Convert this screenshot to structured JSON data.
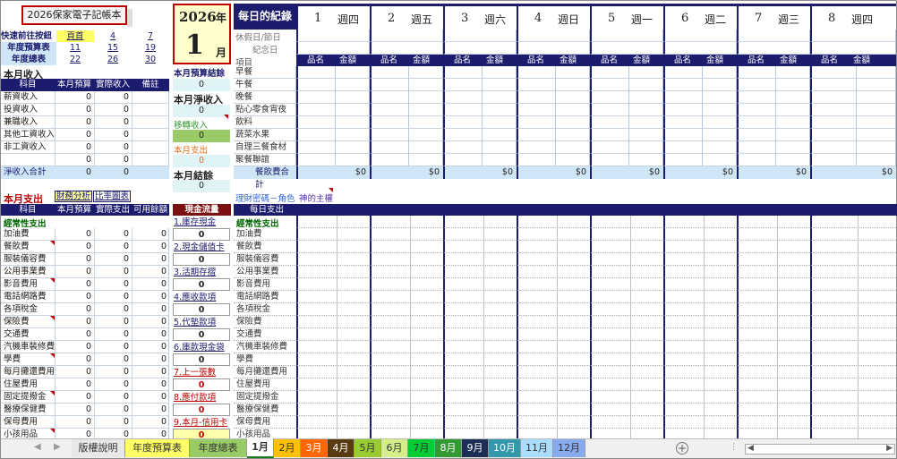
{
  "title_button": "2026保家電子記帳本",
  "quick_nav": {
    "label": "快速前往按鈕",
    "rows": [
      {
        "label": "",
        "links": [
          "頁首",
          "4",
          "7"
        ]
      },
      {
        "label": "年度預算表",
        "links": [
          "11",
          "15",
          "19"
        ]
      },
      {
        "label": "年度總表",
        "links": [
          "22",
          "26",
          "30"
        ]
      }
    ]
  },
  "year_month": {
    "year": "2026",
    "year_unit": "年",
    "month": "1",
    "month_unit": "月"
  },
  "income": {
    "title": "本月收入",
    "headers": [
      "科目",
      "本月預算",
      "實際收入",
      "備註"
    ],
    "rows": [
      {
        "name": "薪資收入",
        "budget": "0",
        "actual": "0"
      },
      {
        "name": "投資收入",
        "budget": "0",
        "actual": "0"
      },
      {
        "name": "兼職收入",
        "budget": "0",
        "actual": "0"
      },
      {
        "name": "其他工資收入",
        "budget": "0",
        "actual": "0"
      },
      {
        "name": "非工資收入",
        "budget": "0",
        "actual": "0"
      },
      {
        "name": "",
        "budget": "0",
        "actual": "0"
      }
    ],
    "total": {
      "name": "淨收入合計",
      "budget": "0",
      "actual": "0"
    }
  },
  "summary": {
    "budget_result_label": "本月預算結餘",
    "budget_result": "0",
    "net_income_label": "本月淨收入",
    "net_income": "0",
    "transfer_label": "移轉收入",
    "transfer": "0",
    "expense_label": "本月支出",
    "expense": "0",
    "balance_label": "本月結餘",
    "balance": "0"
  },
  "expense": {
    "title": "本月支出",
    "links": [
      "財務分析",
      "比率圖表"
    ],
    "headers": [
      "科目",
      "本月預算",
      "實際支出",
      "可用餘額"
    ],
    "section": "經常性支出",
    "rows": [
      {
        "name": "加油費",
        "v": [
          "0",
          "0",
          "0"
        ]
      },
      {
        "name": "餐飲費",
        "v": [
          "0",
          "0",
          "0"
        ]
      },
      {
        "name": "服裝儀容費",
        "v": [
          "0",
          "0",
          "0"
        ]
      },
      {
        "name": "公用事業費",
        "v": [
          "0",
          "0",
          "0"
        ]
      },
      {
        "name": "影音費用",
        "v": [
          "0",
          "0",
          "0"
        ]
      },
      {
        "name": "電話網路費",
        "v": [
          "0",
          "0",
          "0"
        ]
      },
      {
        "name": "各項稅金",
        "v": [
          "0",
          "0",
          "0"
        ]
      },
      {
        "name": "保險費",
        "v": [
          "0",
          "0",
          "0"
        ]
      },
      {
        "name": "交通費",
        "v": [
          "0",
          "0",
          "0"
        ]
      },
      {
        "name": "汽機車裝修費",
        "v": [
          "0",
          "0",
          "0"
        ]
      },
      {
        "name": "學費",
        "v": [
          "0",
          "0",
          "0"
        ]
      },
      {
        "name": "每月攤還費用",
        "v": [
          "0",
          "0",
          "0"
        ]
      },
      {
        "name": "住屋費用",
        "v": [
          "0",
          "0",
          "0"
        ]
      },
      {
        "name": "固定提撥金",
        "v": [
          "0",
          "0",
          "0"
        ]
      },
      {
        "name": "醫療保健費",
        "v": [
          "0",
          "0",
          "0"
        ]
      },
      {
        "name": "保母費用",
        "v": [
          "0",
          "0",
          "0"
        ]
      },
      {
        "name": "小孩用品",
        "v": [
          "0",
          "0",
          "0"
        ]
      }
    ]
  },
  "cash_flow": {
    "title": "現金流量",
    "items": [
      {
        "label": "1.庫存現金",
        "value": "0",
        "red": false
      },
      {
        "label": "2.現金儲值卡",
        "value": "0",
        "red": false
      },
      {
        "label": "3.活期存摺",
        "value": "0",
        "red": false
      },
      {
        "label": "4.應收款項",
        "value": "0",
        "red": false
      },
      {
        "label": "5.代墊款項",
        "value": "0",
        "red": false
      },
      {
        "label": "6.庫款現金袋",
        "value": "0",
        "red": false
      },
      {
        "label": "7.上一張數",
        "value": "0",
        "red": true
      },
      {
        "label": "8.應付款項",
        "value": "0",
        "red": true
      },
      {
        "label": "9.本月-信用卡",
        "value": "0",
        "red": true
      }
    ]
  },
  "daily": {
    "title": "每日的紀錄",
    "days": [
      {
        "d": "1",
        "w": "週四"
      },
      {
        "d": "2",
        "w": "週五"
      },
      {
        "d": "3",
        "w": "週六"
      },
      {
        "d": "4",
        "w": "週日"
      },
      {
        "d": "5",
        "w": "週一"
      },
      {
        "d": "6",
        "w": "週二"
      },
      {
        "d": "7",
        "w": "週三"
      },
      {
        "d": "8",
        "w": "週四"
      }
    ],
    "holiday_label": "休假日/節日",
    "memorial_label": "紀念日",
    "item_label": "項目",
    "col_name": "品名",
    "col_amount": "金額",
    "meals": [
      "早餐",
      "午餐",
      "晚餐",
      "點心零食宵夜",
      "飲料",
      "蔬菜水果",
      "自理三餐食材",
      "聚餐聯誼"
    ],
    "meal_total_label": "餐飲費合計",
    "meal_total_value": "$0",
    "note1": "理財密碼－角色",
    "note2": "神的主權",
    "expense_header": "每日支出",
    "expense_section": "經常性支出",
    "expense_items": [
      "加油費",
      "餐飲費",
      "服裝儀容費",
      "公用事業費",
      "影音費用",
      "電話網路費",
      "各項稅金",
      "保險費",
      "交通費",
      "汽機車裝修費",
      "學費",
      "每月攤還費用",
      "住屋費用",
      "固定提撥金",
      "醫療保健費",
      "保母費用",
      "小孩用品"
    ]
  },
  "sheet_tabs": [
    {
      "label": "版權說明",
      "bg": "#e8e8e8",
      "fg": "#333333"
    },
    {
      "label": "年度預算表",
      "bg": "#ffff66",
      "fg": "#333333"
    },
    {
      "label": "年度總表",
      "bg": "#99cc66",
      "fg": "#333333"
    },
    {
      "label": "1月",
      "bg": "#ffffff",
      "fg": "#333333"
    },
    {
      "label": "2月",
      "bg": "#ffc000",
      "fg": "#333333"
    },
    {
      "label": "3月",
      "bg": "#ff6600",
      "fg": "#ffffff"
    },
    {
      "label": "4月",
      "bg": "#5a3a10",
      "fg": "#ffffff"
    },
    {
      "label": "5月",
      "bg": "#99cc33",
      "fg": "#333333"
    },
    {
      "label": "6月",
      "bg": "#d4ee88",
      "fg": "#333333"
    },
    {
      "label": "7月",
      "bg": "#00cc33",
      "fg": "#333333"
    },
    {
      "label": "8月",
      "bg": "#339933",
      "fg": "#ffffff"
    },
    {
      "label": "9月",
      "bg": "#1c2e55",
      "fg": "#ffffff"
    },
    {
      "label": "10月",
      "bg": "#3399aa",
      "fg": "#ffffff"
    },
    {
      "label": "11月",
      "bg": "#aaddff",
      "fg": "#333333"
    },
    {
      "label": "12月",
      "bg": "#88aaee",
      "fg": "#333333"
    }
  ]
}
